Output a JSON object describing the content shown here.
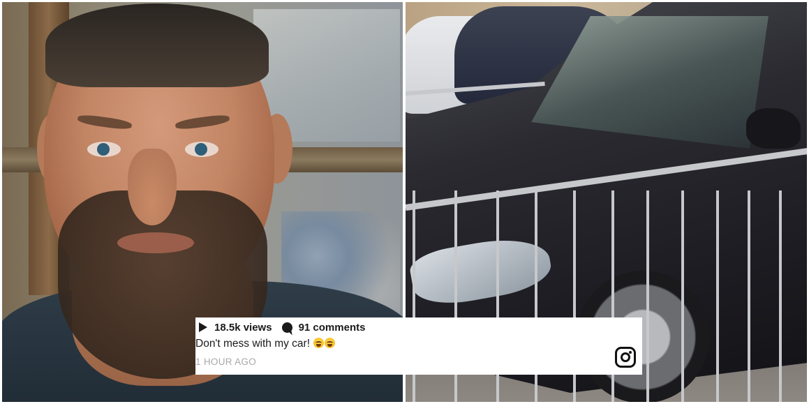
{
  "post": {
    "views": "18.5k views",
    "comments": "91 comments",
    "caption": "Don't mess with my car!",
    "caption_emoji": "😂😂",
    "time_ago": "1 HOUR AGO"
  },
  "icons": {
    "views": "play-icon",
    "comments": "comment-bubble-icon",
    "brand": "instagram-icon"
  },
  "colors": {
    "card_background": "#ffffff",
    "text": "#1a1a1a",
    "timestamp": "#a8a8a8"
  }
}
